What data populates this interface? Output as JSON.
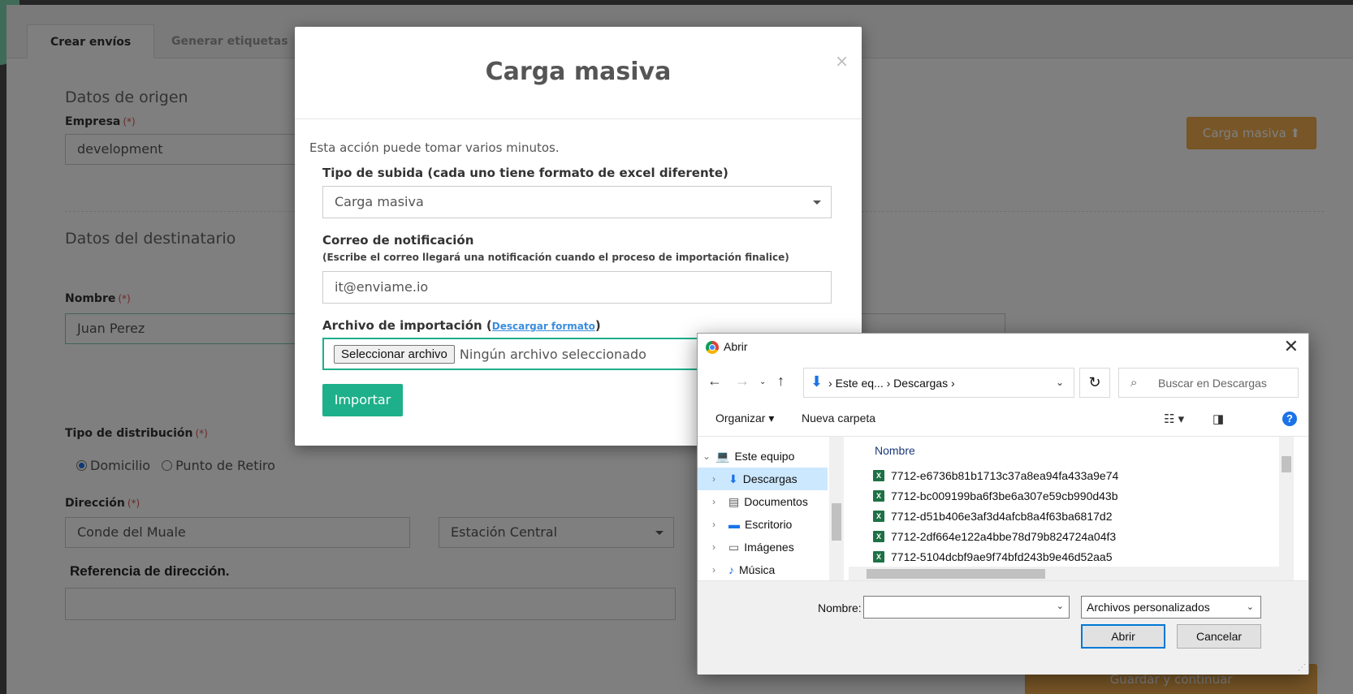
{
  "page": {
    "tabs": [
      "Crear envíos",
      "Generar etiquetas"
    ],
    "origin_section": "Datos de origen",
    "company_label": "Empresa",
    "required_mark": "(*)",
    "company_value": "development",
    "bulk_button": "Carga masiva",
    "recipient_section": "Datos del destinatario",
    "name_label": "Nombre",
    "name_value": "Juan Perez",
    "distribution_label": "Tipo de distribución",
    "radio_home": "Domicilio",
    "radio_pickup": "Punto de Retiro",
    "address_label": "Dirección",
    "address_value": "Conde del Muale",
    "commune_value": "Estación Central",
    "reference_label": "Referencia de dirección.",
    "save_button": "Guardar y continuar"
  },
  "modal": {
    "title": "Carga masiva",
    "close": "×",
    "note": "Esta acción puede tomar varios minutos.",
    "upload_type_label": "Tipo de subida (cada uno tiene formato de excel diferente)",
    "upload_type_value": "Carga masiva",
    "email_label": "Correo de notificación",
    "email_hint": "(Escribe el correo llegará una notificación cuando el proceso de importación finalice)",
    "email_value": "it@enviame.io",
    "file_label": "Archivo de importación",
    "file_link": "Descargar formato",
    "file_button": "Seleccionar archivo",
    "file_status": "Ningún archivo seleccionado",
    "import_button": "Importar"
  },
  "dialog": {
    "title": "Abrir",
    "breadcrumb_1": "Este eq...",
    "breadcrumb_2": "Descargas",
    "search_placeholder": "Buscar en Descargas",
    "organize": "Organizar",
    "new_folder": "Nueva carpeta",
    "tree": [
      "Este equipo",
      "Descargas",
      "Documentos",
      "Escritorio",
      "Imágenes",
      "Música"
    ],
    "column_name": "Nombre",
    "files": [
      "7712-e6736b81b1713c37a8ea94fa433a9e74",
      "7712-bc009199ba6f3be6a307e59cb990d43b",
      "7712-d51b406e3af3d4afcb8a4f63ba6817d2",
      "7712-2df664e122a4bbe78d79b824724a04f3",
      "7712-5104dcbf9ae9f74bfd243b9e46d52aa5"
    ],
    "name_field_label": "Nombre:",
    "file_type": "Archivos personalizados",
    "open_button": "Abrir",
    "cancel_button": "Cancelar"
  }
}
